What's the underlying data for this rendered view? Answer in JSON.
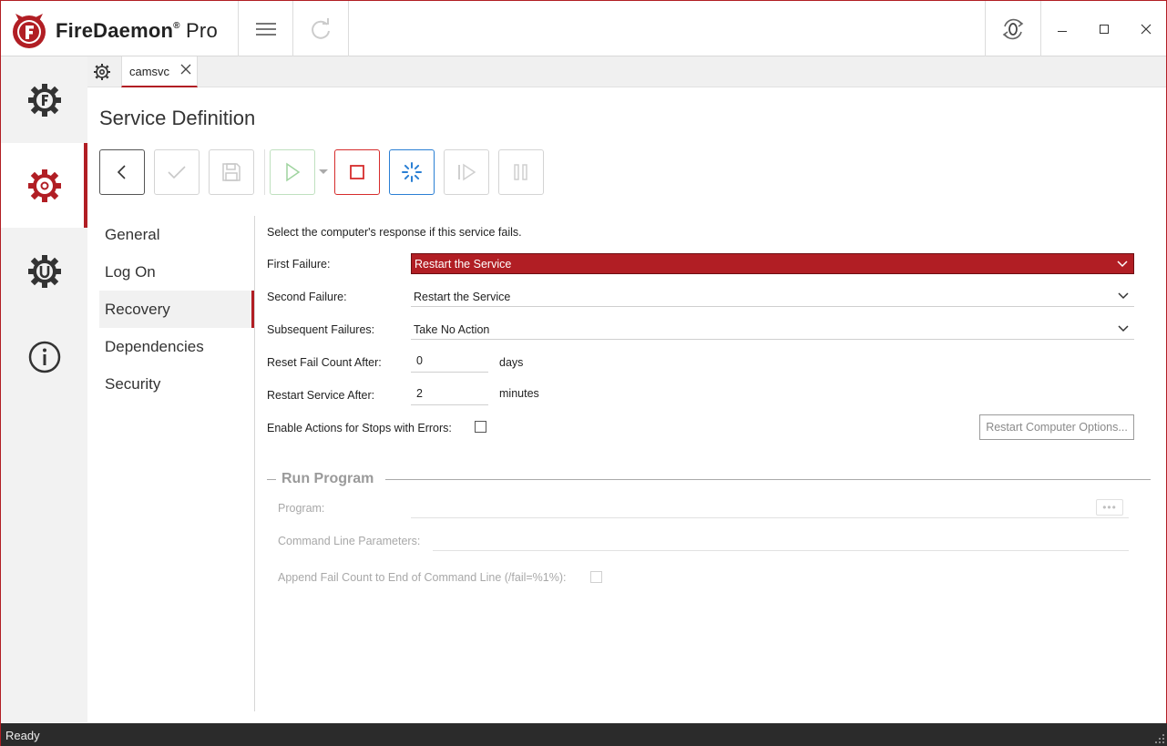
{
  "app": {
    "brand_name": "FireDaemon",
    "brand_suffix": "Pro",
    "brand_mark": "®",
    "accent_color": "#b11e24"
  },
  "titlebar": {
    "icons": [
      "hamburger-menu-icon",
      "refresh-icon",
      "session-zero-icon",
      "minimize-icon",
      "maximize-icon",
      "close-icon"
    ]
  },
  "rail": {
    "items": [
      {
        "icon": "firedaemon-gear-icon",
        "active": false
      },
      {
        "icon": "service-gear-icon",
        "active": true
      },
      {
        "icon": "u-gear-icon",
        "active": false
      },
      {
        "icon": "info-icon",
        "active": false
      }
    ]
  },
  "tabs": [
    {
      "label": "camsvc",
      "active": true
    }
  ],
  "page": {
    "title": "Service Definition"
  },
  "toolbar": {
    "buttons": [
      "back-icon",
      "apply-icon",
      "save-icon",
      "start-icon",
      "stop-icon",
      "restart-icon",
      "step-icon",
      "pause-icon"
    ]
  },
  "nav": {
    "items": [
      {
        "label": "General",
        "active": false
      },
      {
        "label": "Log On",
        "active": false
      },
      {
        "label": "Recovery",
        "active": true
      },
      {
        "label": "Dependencies",
        "active": false
      },
      {
        "label": "Security",
        "active": false
      }
    ]
  },
  "recovery": {
    "intro": "Select the computer's response if this service fails.",
    "first_failure_label": "First Failure:",
    "first_failure_value": "Restart the Service",
    "second_failure_label": "Second Failure:",
    "second_failure_value": "Restart the Service",
    "subsequent_failures_label": "Subsequent Failures:",
    "subsequent_failures_value": "Take No Action",
    "reset_fail_label": "Reset Fail Count After:",
    "reset_fail_value": "0",
    "reset_fail_unit": "days",
    "restart_after_label": "Restart Service After:",
    "restart_after_value": "2",
    "restart_after_unit": "minutes",
    "enable_actions_label": "Enable Actions for Stops with Errors:",
    "enable_actions_checked": false,
    "restart_computer_button": "Restart Computer Options...",
    "run_program": {
      "title": "Run Program",
      "program_label": "Program:",
      "program_value": "",
      "params_label": "Command Line Parameters:",
      "params_value": "",
      "append_label": "Append Fail Count to End of Command Line (/fail=%1%):",
      "append_checked": false,
      "browse_label": "•••"
    }
  },
  "status": {
    "text": "Ready"
  }
}
